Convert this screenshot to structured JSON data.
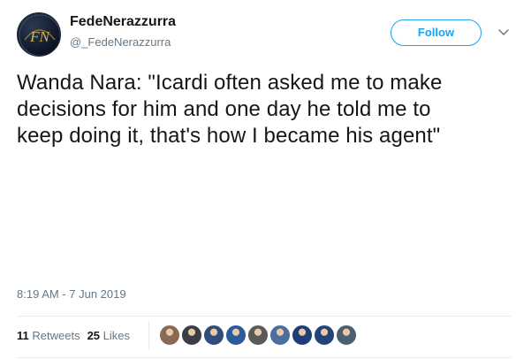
{
  "user": {
    "name": "FedeNerazzurra",
    "handle": "@_FedeNerazzurra",
    "avatar_monogram": "FN"
  },
  "follow_label": "Follow",
  "tweet": {
    "line1": "Wanda Nara: \"Icardi often asked me to make",
    "line2": "decisions for him and one day he told me to",
    "line3": "keep doing it, that's how I became his agent\""
  },
  "timestamp": "8:19 AM - 7 Jun 2019",
  "stats": {
    "retweets_count": "11",
    "retweets_label": "Retweets",
    "likes_count": "25",
    "likes_label": "Likes"
  },
  "colors": {
    "accent": "#1da1f2",
    "text": "#14171a",
    "muted": "#657786",
    "divider": "#e6ecf0"
  },
  "likers": [
    {
      "icon": "liker-avatar-1",
      "color": "#8a6a55"
    },
    {
      "icon": "liker-avatar-2",
      "color": "#3a3d44"
    },
    {
      "icon": "liker-avatar-3",
      "color": "#2f4f7a"
    },
    {
      "icon": "liker-avatar-4",
      "color": "#2a5c9a"
    },
    {
      "icon": "liker-avatar-5",
      "color": "#5a5a5a"
    },
    {
      "icon": "liker-avatar-6",
      "color": "#4a6f9c"
    },
    {
      "icon": "liker-avatar-7",
      "color": "#1f3d78"
    },
    {
      "icon": "liker-avatar-8",
      "color": "#22447a"
    },
    {
      "icon": "liker-avatar-9",
      "color": "#4d5e6e"
    }
  ]
}
